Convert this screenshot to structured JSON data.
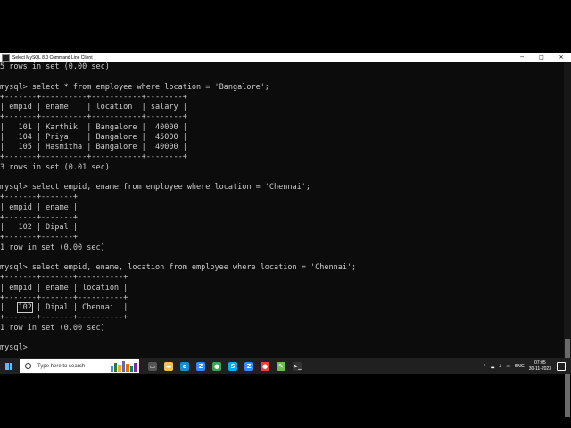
{
  "window": {
    "title": "Select MySQL 8.0 Command Line Client"
  },
  "controls": {
    "minimize": "─",
    "maximize": "□",
    "close": "✕"
  },
  "console_lines": [
    "5 rows in set (0.00 sec)",
    "",
    "mysql> select * from employee where location = 'Bangalore';",
    "+-------+----------+-----------+--------+",
    "| empid | ename    | location  | salary |",
    "+-------+----------+-----------+--------+",
    "|   101 | Karthik  | Bangalore |  40000 |",
    "|   104 | Priya    | Bangalore |  45000 |",
    "|   105 | Hasmitha | Bangalore |  40000 |",
    "+-------+----------+-----------+--------+",
    "3 rows in set (0.01 sec)",
    "",
    "mysql> select empid, ename from employee where location = 'Chennai';",
    "+-------+-------+",
    "| empid | ename |",
    "+-------+-------+",
    "|   102 | Dipal |",
    "+-------+-------+",
    "1 row in set (0.00 sec)",
    "",
    "mysql> select empid, ename, location from employee where location = 'Chennai';",
    "+-------+-------+----------+",
    "| empid | ename | location |",
    "+-------+-------+----------+",
    "|   102 | Dipal | Chennai  |",
    "+-------+-------+----------+",
    "1 row in set (0.00 sec)",
    "",
    "mysql> "
  ],
  "taskbar": {
    "search_placeholder": "Type here to search",
    "icons": [
      {
        "name": "task-view-icon",
        "glyph": "▭",
        "color": "#555555"
      },
      {
        "name": "file-explorer-icon",
        "glyph": "▬",
        "color": "#f2c14e"
      },
      {
        "name": "edge-icon",
        "glyph": "e",
        "color": "#1f8ad2"
      },
      {
        "name": "zoom-icon",
        "glyph": "Z",
        "color": "#2d8cff"
      },
      {
        "name": "chrome-icon",
        "glyph": "●",
        "color": "#34a853"
      },
      {
        "name": "skype-icon",
        "glyph": "S",
        "color": "#00aff0"
      },
      {
        "name": "zoom-icon-2",
        "glyph": "Z",
        "color": "#2d8cff"
      },
      {
        "name": "chrome-profile-icon",
        "glyph": "●",
        "color": "#ea4335"
      },
      {
        "name": "notepad-icon",
        "glyph": "✎",
        "color": "#6cbf4a"
      },
      {
        "name": "terminal-icon",
        "glyph": ">_",
        "color": "#333333"
      }
    ],
    "tray_language": "ENG",
    "time": "07:05",
    "date": "30-11-2023"
  },
  "colors": {
    "console_bg": "#0c0c0c",
    "console_text": "#cccccc",
    "taskbar_bg": "#202020",
    "accent": "#60cdff"
  }
}
